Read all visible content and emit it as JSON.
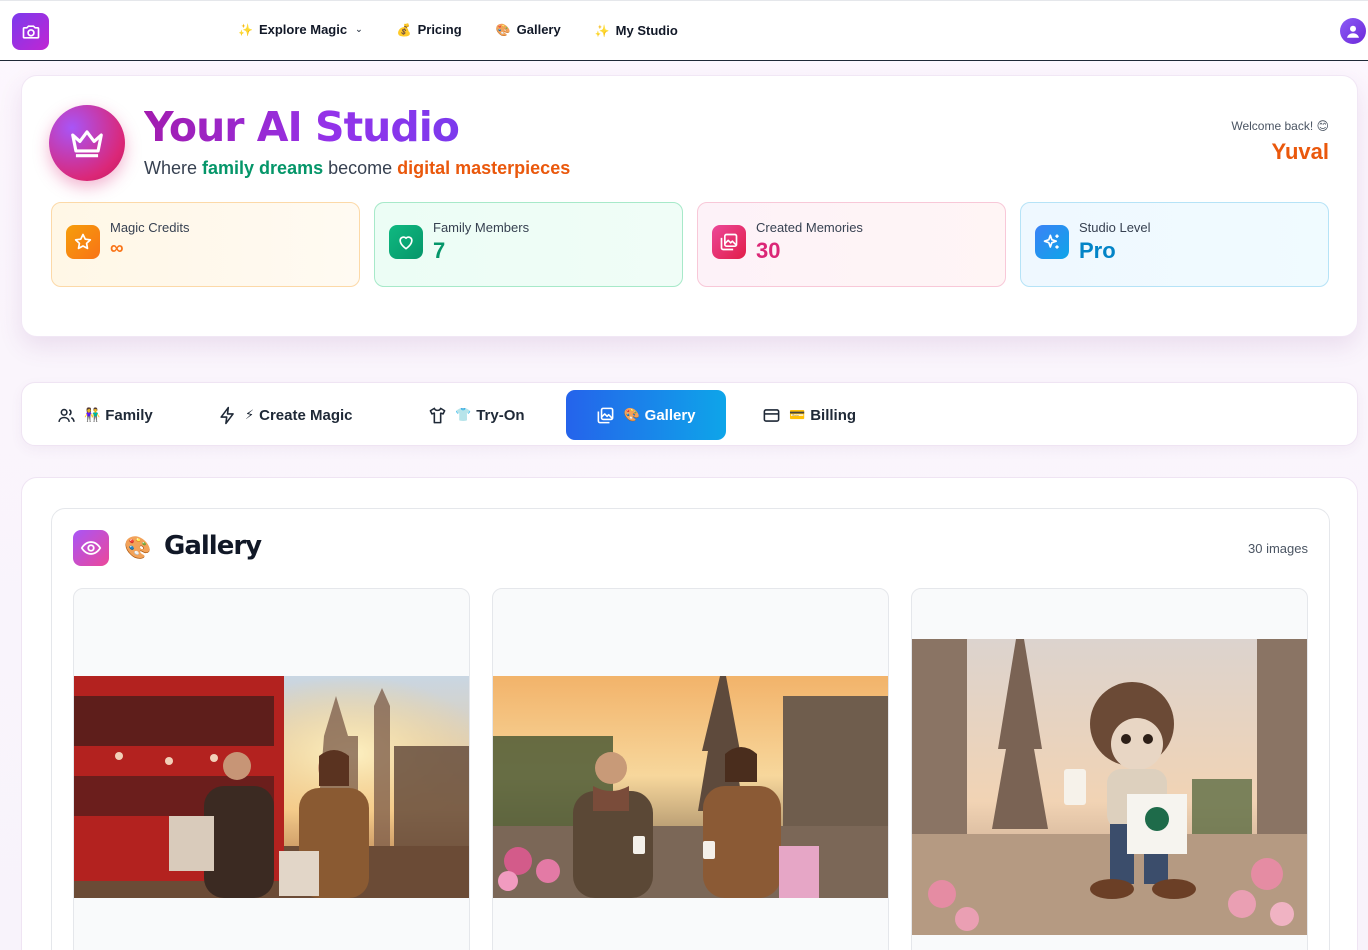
{
  "nav": {
    "items": [
      {
        "emoji": "✨",
        "label": "Explore Magic",
        "has_dropdown": true
      },
      {
        "emoji": "💰",
        "label": "Pricing"
      },
      {
        "emoji": "🎨",
        "label": "Gallery"
      },
      {
        "emoji": "✨",
        "label": "My Studio"
      }
    ]
  },
  "hero": {
    "title": "Your AI Studio",
    "subtitle_1": "Where ",
    "subtitle_2": "family dreams",
    "subtitle_3": " become ",
    "subtitle_4": "digital masterpieces",
    "welcome": "Welcome back! 😊",
    "username": "Yuval"
  },
  "stats": [
    {
      "label": "Magic Credits",
      "value": "∞",
      "icon": "star-icon"
    },
    {
      "label": "Family Members",
      "value": "7",
      "icon": "heart-icon"
    },
    {
      "label": "Created Memories",
      "value": "30",
      "icon": "image-icon"
    },
    {
      "label": "Studio Level",
      "value": "Pro",
      "icon": "sparkles-icon"
    }
  ],
  "tabs": [
    {
      "label": "Family",
      "emoji": "👫",
      "icon": "users-icon"
    },
    {
      "label": "Create Magic",
      "emoji": "⚡",
      "icon": "lightning-icon"
    },
    {
      "label": "Try-On",
      "emoji": "👕",
      "icon": "shirt-icon"
    },
    {
      "label": "Gallery",
      "emoji": "🎨",
      "icon": "images-icon",
      "active": true
    },
    {
      "label": "Billing",
      "emoji": "💳",
      "icon": "credit-card-icon"
    }
  ],
  "gallery": {
    "emoji": "🎨",
    "title": "Gallery",
    "count": "30 images",
    "images": [
      {
        "subject": "couple-shopping-london"
      },
      {
        "subject": "couple-coffee-paris"
      },
      {
        "subject": "plush-character-paris"
      }
    ]
  },
  "colors": {
    "brand_purple": "#9333ea",
    "accent_orange": "#ea580c",
    "accent_green": "#059669",
    "active_tab": "#2563eb"
  }
}
